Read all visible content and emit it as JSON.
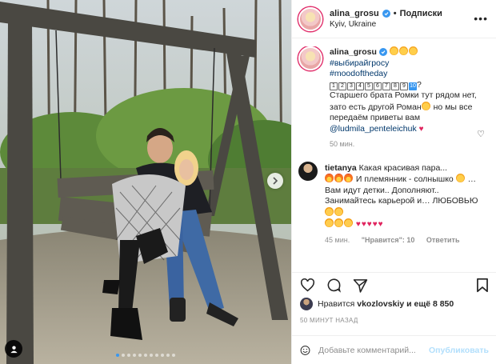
{
  "post": {
    "author": "alina_grosu",
    "separator": "•",
    "follow_label": "Подписки",
    "location": "Kyiv, Ukraine",
    "more_label": "•••"
  },
  "caption": {
    "username": "alina_grosu",
    "hashtag1": "#выбирайгросу",
    "hashtag2": "#moodoftheday",
    "numbers": [
      "1",
      "2",
      "3",
      "4",
      "5",
      "6",
      "7",
      "8",
      "9",
      "10"
    ],
    "question_mark": "?",
    "line1": "Старшего брата Ромки тут рядом нет,",
    "line2": "зато есть другой Роман",
    "line3": " но мы все передаём приветы вам",
    "mention": "@ludmila_penteleichuk",
    "time": "50 мин."
  },
  "comment": {
    "username": "tietanya",
    "text_part1": " Какая красивая пара...",
    "text_part2": " И племянник - солнышко ",
    "text_part3": " … Вам идут детки.. ",
    "text_part4": "Дополняют.. Занимайтесь карьерой и… ЛЮБОВЬЮ",
    "time": "45 мин.",
    "likes": "\"Нравится\": 10",
    "reply": "Ответить"
  },
  "likes": {
    "prefix": "Нравится ",
    "user": "vkozlovskiy",
    "suffix": " и ещё 8 850"
  },
  "timestamp": "50 МИНУТ НАЗАД",
  "add_comment": {
    "placeholder": "Добавьте комментарий...",
    "publish": "Опубликовать"
  },
  "carousel": {
    "count": 11,
    "active_index": 0
  },
  "colors": {
    "accent": "#3897f0",
    "heart": "#e0245e",
    "publish_disabled": "#b2dffc",
    "meta_gray": "#8e8e8e"
  },
  "icons": [
    "user-tag-icon",
    "next-arrow-icon",
    "verified-icon",
    "more-icon",
    "heart-icon",
    "comment-icon",
    "share-icon",
    "bookmark-icon",
    "emoji-icon"
  ]
}
